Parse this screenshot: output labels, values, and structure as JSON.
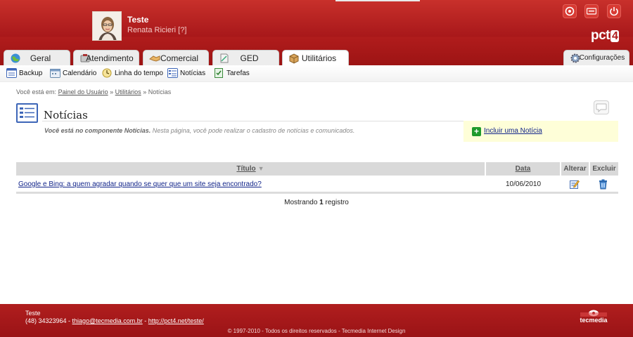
{
  "header": {
    "user_name": "Teste",
    "user_sub": "Renata Ricieri [?]",
    "logo_text": "pct",
    "logo_num": "4",
    "top_icons": [
      "lifebuoy-icon",
      "keyboard-icon",
      "power-icon"
    ]
  },
  "tabs": [
    {
      "label": "Geral",
      "icon": "globe-icon"
    },
    {
      "label": "Atendimento",
      "icon": "phone-icon"
    },
    {
      "label": "Comercial",
      "icon": "handshake-icon"
    },
    {
      "label": "GED",
      "icon": "document-icon"
    },
    {
      "label": "Utilitários",
      "icon": "box-icon",
      "active": true
    },
    {
      "label": "Configurações",
      "icon": "gear-icon"
    }
  ],
  "subnav": [
    {
      "label": "Backup"
    },
    {
      "label": "Calendário"
    },
    {
      "label": "Linha do tempo"
    },
    {
      "label": "Notícias"
    },
    {
      "label": "Tarefas"
    }
  ],
  "breadcrumb": {
    "prefix": "Você está em:",
    "link1": "Painel do Usuário",
    "sep": "»",
    "link2": "Utilitários",
    "current": "Notícias"
  },
  "page": {
    "title": "Notícias",
    "desc_bold": "Você está no componente Notícias.",
    "desc_rest": " Nesta página, você pode realizar o cadastro de notícias e comunicados.",
    "add_label": "Incluir uma Notícia"
  },
  "table": {
    "headers": {
      "title": "Título",
      "date": "Data",
      "edit": "Alterar",
      "delete": "Excluir"
    },
    "sort_arrow": "▼",
    "rows": [
      {
        "title": "Google e Bing: a quem agradar quando se quer que um site seja encontrado?",
        "date": "10/06/2010"
      }
    ],
    "showing_prefix": "Mostrando ",
    "showing_count": "1",
    "showing_suffix": " registro"
  },
  "footer": {
    "name": "Teste",
    "phone": "(48) 34323964 - ",
    "email": "thiago@tecmedia.com.br",
    "dash": " - ",
    "url": "http://pct4.net/teste/",
    "copyright": "© 1997-2010 - Todos os direitos reservados - Tecmedia Internet Design",
    "logo": "tecmedia"
  },
  "colors": {
    "brand": "#b41c1c",
    "link": "#12258a",
    "add_bg": "#fefed8",
    "add_btn": "#1f9a2b"
  }
}
